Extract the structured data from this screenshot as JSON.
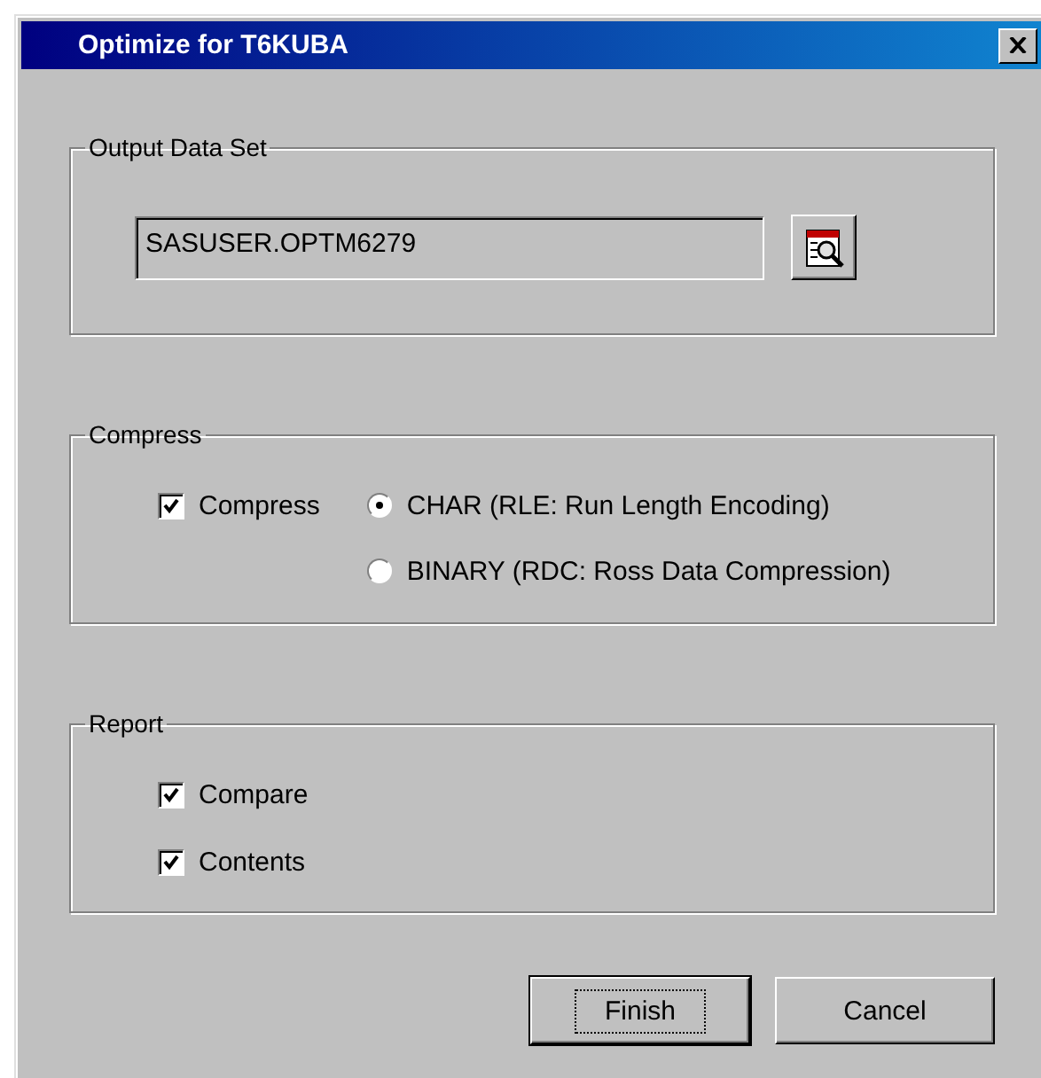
{
  "window": {
    "title": "Optimize for T6KUBA"
  },
  "output_data_set": {
    "legend": "Output Data Set",
    "value": "SASUSER.OPTM6279"
  },
  "compress": {
    "legend": "Compress",
    "checkbox": {
      "label": "Compress",
      "checked": true
    },
    "options": [
      {
        "label": "CHAR (RLE: Run Length Encoding)",
        "selected": true
      },
      {
        "label": "BINARY (RDC: Ross Data Compression)",
        "selected": false
      }
    ]
  },
  "report": {
    "legend": "Report",
    "items": [
      {
        "label": "Compare",
        "checked": true
      },
      {
        "label": "Contents",
        "checked": true
      }
    ]
  },
  "buttons": [
    {
      "label": "Finish",
      "default": true
    },
    {
      "label": "Cancel",
      "default": false
    }
  ]
}
